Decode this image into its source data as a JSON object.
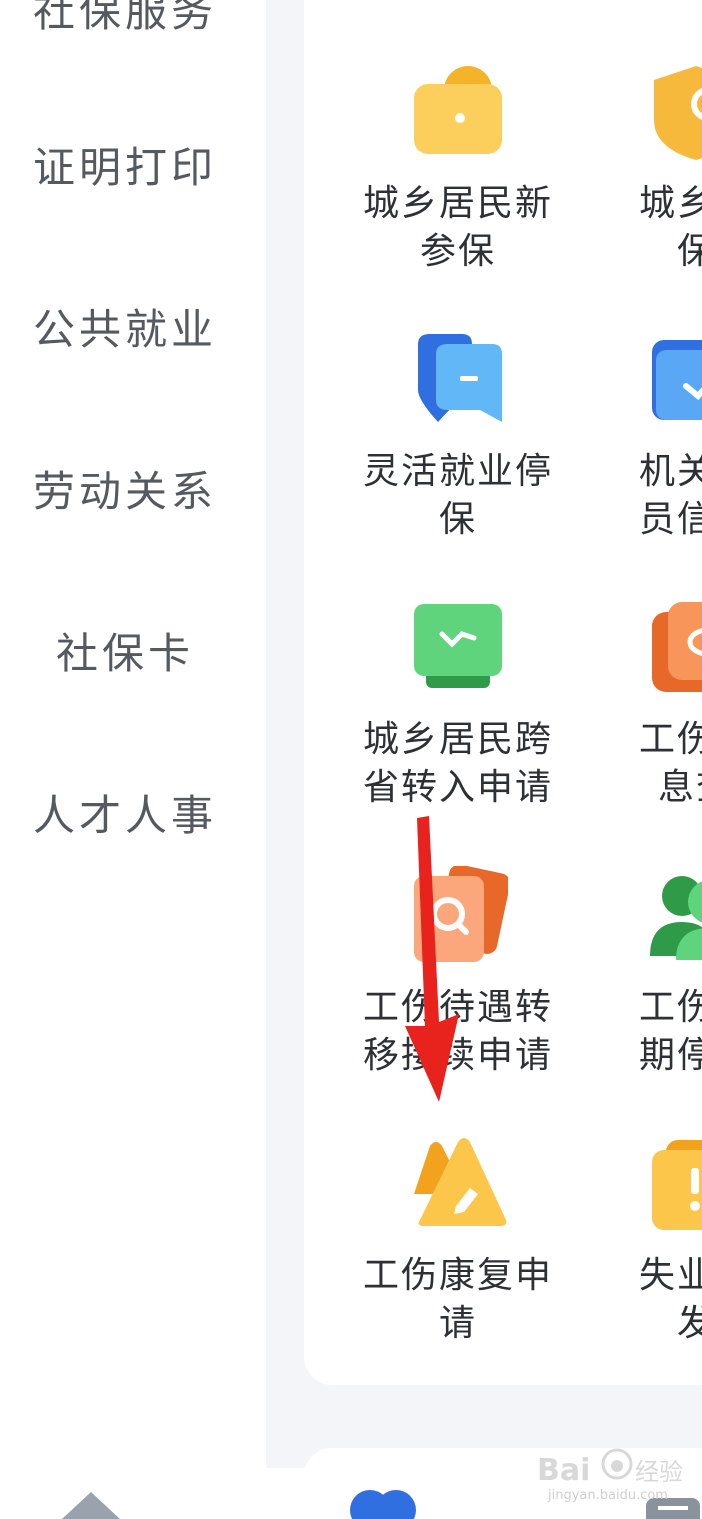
{
  "sidebar": {
    "items": [
      {
        "label": "社保服务"
      },
      {
        "label": "证明打印"
      },
      {
        "label": "公共就业"
      },
      {
        "label": "劳动关系"
      },
      {
        "label": "社保卡"
      },
      {
        "label": "人才人事"
      }
    ]
  },
  "services": [
    {
      "label": "城乡居民新参保",
      "icon": "folder-icon",
      "color": "#f8c24a"
    },
    {
      "label": "城乡居保",
      "icon": "shield-icon",
      "color": "#f6b93b"
    },
    {
      "label": "灵活就业停保",
      "icon": "chat-icon",
      "color": "#3d8bf5"
    },
    {
      "label": "机关养员信息",
      "icon": "check-card-icon",
      "color": "#3d8bf5"
    },
    {
      "label": "城乡居民跨省转入申请",
      "icon": "transfer-icon",
      "color": "#3fbf5b"
    },
    {
      "label": "工伤认息查",
      "icon": "eye-icon",
      "color": "#f47c3a"
    },
    {
      "label": "工伤待遇转移接续申请",
      "icon": "search-doc-icon",
      "color": "#f47c3a"
    },
    {
      "label": "工伤待期停发",
      "icon": "users-icon",
      "color": "#3fbf5b"
    },
    {
      "label": "工伤康复申请",
      "icon": "triangle-edit-icon",
      "color": "#f6b93b"
    },
    {
      "label": "失业待发",
      "icon": "alert-icon",
      "color": "#f6b93b"
    }
  ],
  "services_display": {
    "s0": {
      "line1": "城乡居民新",
      "line2": "参保"
    },
    "s1": {
      "line1": "城乡居",
      "line2": "保"
    },
    "s2": {
      "line1": "灵活就业停",
      "line2": "保"
    },
    "s3": {
      "line1": "机关养",
      "line2": "员信息"
    },
    "s4": {
      "line1": "城乡居民跨",
      "line2": "省转入申请"
    },
    "s5": {
      "line1": "工伤认",
      "line2": "息查"
    },
    "s6": {
      "line1": "工伤待遇转",
      "line2": "移接续申请"
    },
    "s7": {
      "line1": "工伤待",
      "line2": "期停发"
    },
    "s8": {
      "line1": "工伤康复申",
      "line2": "请"
    },
    "s9": {
      "line1": "失业待",
      "line2": "发"
    }
  },
  "watermark": {
    "brand": "Bai",
    "suffix": "经验",
    "url": "jingyan.baidu.com"
  },
  "colors": {
    "accent_blue": "#3d8bf5",
    "arrow_red": "#e8231e",
    "sidebar_text": "#555a61"
  }
}
